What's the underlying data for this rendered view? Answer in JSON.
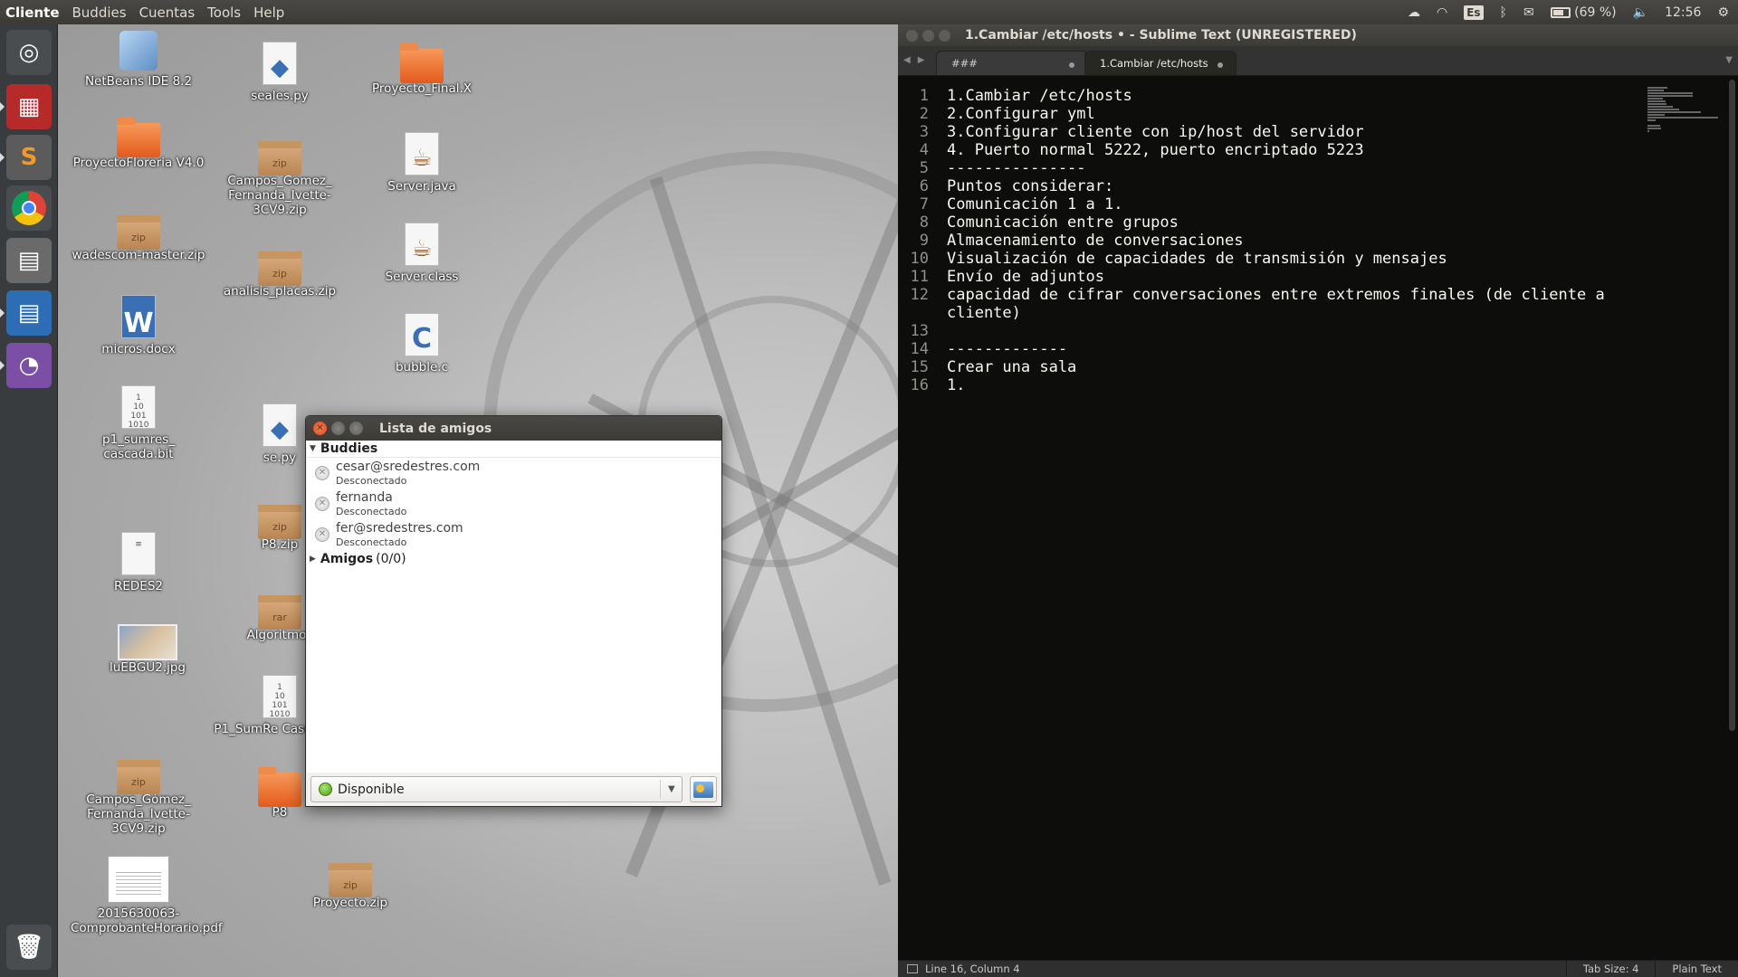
{
  "top_panel": {
    "app_name": "Cliente",
    "menus": [
      "Buddies",
      "Cuentas",
      "Tools",
      "Help"
    ],
    "keyboard_layout": "Es",
    "battery": "(69 %)",
    "battery_fraction": 0.69,
    "clock": "12:56"
  },
  "launcher": {
    "items": [
      "dash-home",
      "media-app",
      "sublime-text",
      "chrome",
      "file-manager",
      "libreoffice-writer",
      "pidgin"
    ],
    "trash": "trash"
  },
  "desktop_icons": [
    {
      "label": "NetBeans IDE 8.2",
      "icon": "cube-icon"
    },
    {
      "label": "ProyectoFloreria V4.0",
      "icon": "folder-icon"
    },
    {
      "label": "wadescom-master.zip",
      "icon": "archive-icon"
    },
    {
      "label": "micros.docx",
      "icon": "word-icon"
    },
    {
      "label": "p1_sumres_ cascada.bit",
      "icon": "binary-file-icon"
    },
    {
      "label": "REDES2",
      "icon": "text-file-icon"
    },
    {
      "label": "luEBGU2.jpg",
      "icon": "image-icon"
    },
    {
      "label": "Campos_Gómez_ Fernanda_Ivette-3CV9.zip",
      "icon": "archive-icon"
    },
    {
      "label": "2015630063-ComprobanteHorario.pdf",
      "icon": "pdf-icon"
    },
    {
      "label": "seales.py",
      "icon": "python-icon"
    },
    {
      "label": "Campos_Gomez_ Fernanda_Ivette-3CV9.zip",
      "icon": "archive-icon"
    },
    {
      "label": "analisis_placas.zip",
      "icon": "archive-icon"
    },
    {
      "label": "se.py",
      "icon": "python-icon"
    },
    {
      "label": "P8.zip",
      "icon": "archive-icon"
    },
    {
      "label": "Algoritmos",
      "icon": "rar-icon"
    },
    {
      "label": "P1_SumRe Cascada.b",
      "icon": "binary-file-icon"
    },
    {
      "label": "P8",
      "icon": "folder-icon"
    },
    {
      "label": "Proyecto_Final.X",
      "icon": "folder-icon"
    },
    {
      "label": "Server.java",
      "icon": "java-icon"
    },
    {
      "label": "Server.class",
      "icon": "java-icon"
    },
    {
      "label": "bubble.c",
      "icon": "c-file-icon"
    },
    {
      "label": "Proyecto.zip",
      "icon": "archive-icon"
    }
  ],
  "buddy_window": {
    "title": "Lista de amigos",
    "group_buddies": "Buddies",
    "buddies": [
      {
        "name": "cesar@sredestres.com",
        "status": "Desconectado"
      },
      {
        "name": "fernanda",
        "status": "Desconectado"
      },
      {
        "name": "fer@sredestres.com",
        "status": "Desconectado"
      }
    ],
    "group_amigos": "Amigos",
    "group_amigos_count": "(0/0)",
    "status_value": "Disponible"
  },
  "sublime": {
    "title": "1.Cambiar /etc/hosts • - Sublime Text (UNREGISTERED)",
    "tabs": [
      {
        "label": "###"
      },
      {
        "label": "1.Cambiar /etc/hosts"
      }
    ],
    "line_numbers": [
      "1",
      "2",
      "3",
      "4",
      "5",
      "6",
      "7",
      "8",
      "9",
      "10",
      "11",
      "12",
      "",
      "13",
      "14",
      "15",
      "16"
    ],
    "code_lines": [
      "1.Cambiar /etc/hosts",
      "2.Configurar yml",
      "3.Configurar cliente con ip/host del servidor",
      "4. Puerto normal 5222, puerto encriptado 5223",
      "---------------",
      "Puntos considerar:",
      "Comunicación 1 a 1.",
      "Comunicación entre grupos",
      "Almacenamiento de conversaciones",
      "Visualización de capacidades de transmisión y mensajes",
      "Envío de adjuntos",
      "capacidad de cifrar conversaciones entre extremos finales (de cliente a",
      "cliente)",
      "",
      "-------------",
      "Crear una sala",
      "1."
    ],
    "status_position": "Line 16, Column 4",
    "status_tab_size": "Tab Size: 4",
    "status_syntax": "Plain Text"
  }
}
